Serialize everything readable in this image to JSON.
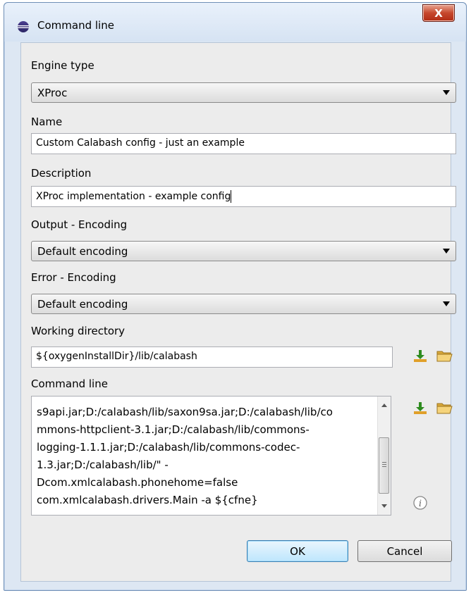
{
  "window": {
    "title": "Command line",
    "close_label": "X"
  },
  "form": {
    "engine_type": {
      "label": "Engine type",
      "value": "XProc"
    },
    "name": {
      "label": "Name",
      "value": "Custom Calabash config - just an example"
    },
    "description": {
      "label": "Description",
      "value": "XProc implementation - example config"
    },
    "output_encoding": {
      "label": "Output - Encoding",
      "value": "Default encoding"
    },
    "error_encoding": {
      "label": "Error - Encoding",
      "value": "Default encoding"
    },
    "working_directory": {
      "label": "Working directory",
      "value": "${oxygenInstallDir}/lib/calabash"
    },
    "command_line": {
      "label": "Command line",
      "value": "s9api.jar;D:/calabash/lib/saxon9sa.jar;D:/calabash/lib/co\nmmons-httpclient-3.1.jar;D:/calabash/lib/commons-\nlogging-1.1.1.jar;D:/calabash/lib/commons-codec-\n1.3.jar;D:/calabash/lib/\" -\nDcom.xmlcalabash.phonehome=false\ncom.xmlcalabash.drivers.Main -a ${cfne}"
    }
  },
  "buttons": {
    "ok": "OK",
    "cancel": "Cancel"
  },
  "icons": {
    "title": "eclipse-icon",
    "insert_variable": "insert-editor-variable-icon",
    "browse": "open-folder-icon",
    "info": "info-icon"
  },
  "colors": {
    "close_button": "#c6472c",
    "ok_button_border": "#3c7fb1",
    "insert_variable_arrow": "#2e8b1f",
    "folder": "#f0c14b"
  }
}
